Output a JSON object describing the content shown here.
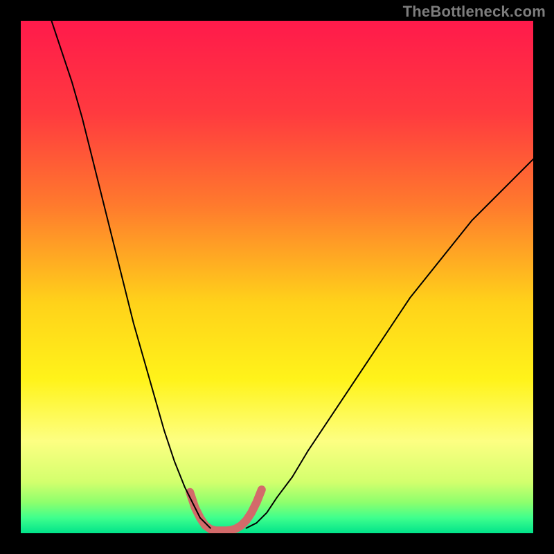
{
  "watermark": "TheBottleneck.com",
  "chart_data": {
    "type": "line",
    "title": "",
    "xlabel": "",
    "ylabel": "",
    "xlim": [
      0,
      100
    ],
    "ylim": [
      0,
      100
    ],
    "grid": false,
    "background_gradient": {
      "stops": [
        {
          "pos": 0.0,
          "color": "#ff1a4b"
        },
        {
          "pos": 0.18,
          "color": "#ff3a3f"
        },
        {
          "pos": 0.36,
          "color": "#ff7a2d"
        },
        {
          "pos": 0.55,
          "color": "#ffd21a"
        },
        {
          "pos": 0.7,
          "color": "#fff31a"
        },
        {
          "pos": 0.82,
          "color": "#fdff82"
        },
        {
          "pos": 0.9,
          "color": "#d3ff6d"
        },
        {
          "pos": 0.94,
          "color": "#8dff6d"
        },
        {
          "pos": 0.97,
          "color": "#3fff8d"
        },
        {
          "pos": 1.0,
          "color": "#00e38a"
        }
      ]
    },
    "series": [
      {
        "name": "left-curve",
        "type": "line",
        "color": "#000000",
        "width": 2,
        "x": [
          6,
          8,
          10,
          12,
          14,
          16,
          18,
          20,
          22,
          24,
          26,
          28,
          30,
          32,
          34,
          35,
          36,
          37
        ],
        "y": [
          100,
          94,
          88,
          81,
          73,
          65,
          57,
          49,
          41,
          34,
          27,
          20,
          14,
          9,
          5,
          3,
          2,
          1
        ]
      },
      {
        "name": "right-curve",
        "type": "line",
        "color": "#000000",
        "width": 2,
        "x": [
          44,
          46,
          48,
          50,
          53,
          56,
          60,
          64,
          68,
          72,
          76,
          80,
          84,
          88,
          92,
          96,
          100
        ],
        "y": [
          1,
          2,
          4,
          7,
          11,
          16,
          22,
          28,
          34,
          40,
          46,
          51,
          56,
          61,
          65,
          69,
          73
        ]
      },
      {
        "name": "highlight-band",
        "type": "line",
        "color": "#d36a6a",
        "width": 12,
        "x": [
          33,
          34,
          35,
          36,
          37,
          38,
          39,
          40,
          41,
          42,
          43,
          44,
          45,
          46,
          47
        ],
        "y": [
          8,
          5,
          3,
          1.5,
          0.8,
          0.5,
          0.5,
          0.5,
          0.6,
          0.9,
          1.5,
          2.5,
          4,
          6,
          8.5
        ]
      }
    ],
    "note": "No numeric axis ticks or labels are visible; x/y values are relative percentages (0-100) estimated from the plot geometry."
  }
}
